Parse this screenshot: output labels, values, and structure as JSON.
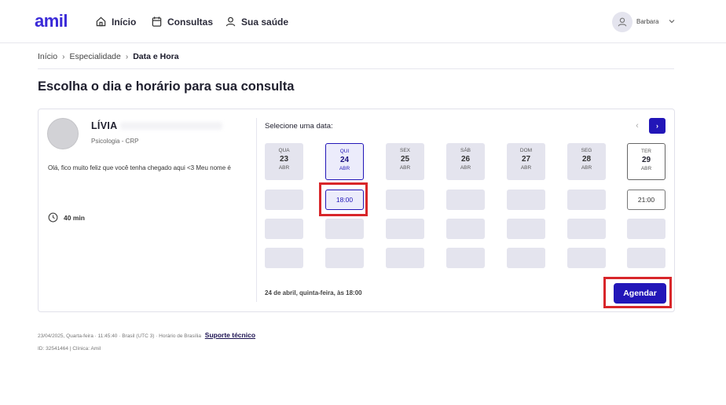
{
  "header": {
    "logo": "amil",
    "nav": [
      {
        "label": "Início",
        "icon": "home-icon"
      },
      {
        "label": "Consultas",
        "icon": "calendar-icon"
      },
      {
        "label": "Sua saúde",
        "icon": "person-icon"
      }
    ],
    "user_name": "Barbara"
  },
  "breadcrumb": {
    "items": [
      "Início",
      "Especialidade",
      "Data e Hora"
    ]
  },
  "page_title": "Escolha o dia e horário para sua consulta",
  "professional": {
    "name": "LÍVIA",
    "specialty": "Psicologia - CRP",
    "description": "Olá, fico muito feliz que você tenha chegado aqui <3 Meu nome é",
    "duration": "40 min"
  },
  "schedule": {
    "select_label": "Selecione uma data:",
    "prev_label": "‹",
    "next_label": "›",
    "dates": [
      {
        "dow": "QUA",
        "day": "23",
        "month": "ABR",
        "state": "disabled"
      },
      {
        "dow": "QUI",
        "day": "24",
        "month": "ABR",
        "state": "selected"
      },
      {
        "dow": "SEX",
        "day": "25",
        "month": "ABR",
        "state": "disabled"
      },
      {
        "dow": "SÁB",
        "day": "26",
        "month": "ABR",
        "state": "disabled"
      },
      {
        "dow": "DOM",
        "day": "27",
        "month": "ABR",
        "state": "disabled"
      },
      {
        "dow": "SEG",
        "day": "28",
        "month": "ABR",
        "state": "disabled"
      },
      {
        "dow": "TER",
        "day": "29",
        "month": "ABR",
        "state": "available"
      }
    ],
    "slots": {
      "qui_selected": "18:00",
      "ter_available": "21:00"
    },
    "summary": "24 de abril, quinta-feira, às 18:00",
    "submit_label": "Agendar"
  },
  "footer": {
    "info": "23/04/2025, Quarta-feira · 11:45:40 · Brasil (UTC 3) · Horário de Brasília",
    "support_link": "Suporte técnico",
    "ids": "ID: 32541464 | Clínica: Amil"
  },
  "colors": {
    "brand": "#2216b8",
    "logo": "#3a2ad8",
    "highlight": "#d8262a"
  }
}
